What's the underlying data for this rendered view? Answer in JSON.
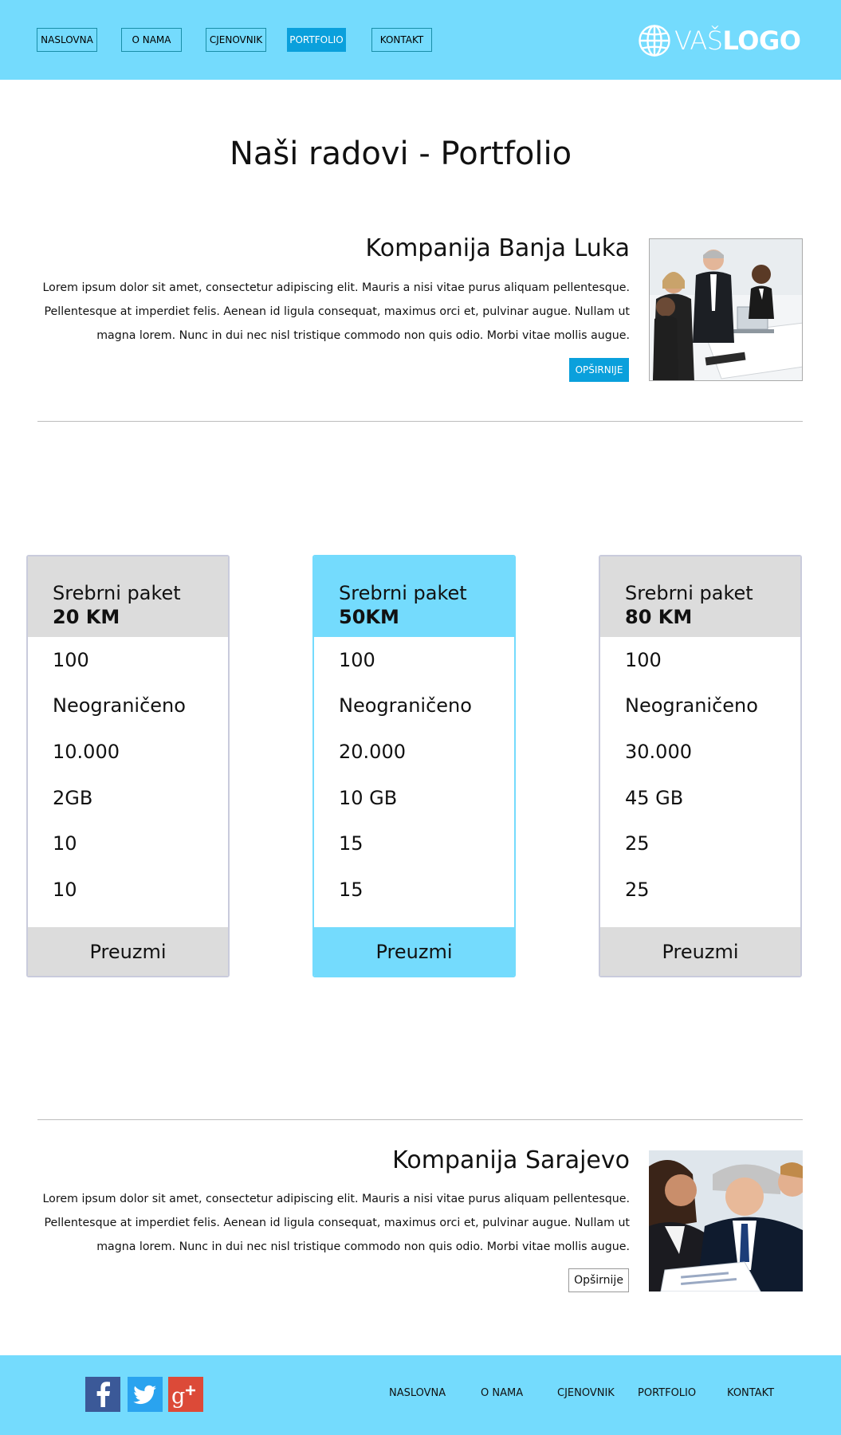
{
  "header": {
    "nav": [
      {
        "label": "NASLOVNA",
        "active": false
      },
      {
        "label": "O NAMA",
        "active": false
      },
      {
        "label": "CJENOVNIK",
        "active": false
      },
      {
        "label": "PORTFOLIO",
        "active": true
      },
      {
        "label": "KONTAKT",
        "active": false
      }
    ],
    "logo": {
      "prefix": "VAŠ",
      "suffix": "LOGO",
      "icon": "globe-icon"
    }
  },
  "page_title": "Naši radovi - Portfolio",
  "portfolio": [
    {
      "title": "Kompanija Banja Luka",
      "description": "Lorem ipsum dolor sit amet, consectetur adipiscing elit. Mauris a nisi vitae purus aliquam pellentesque. Pellentesque at imperdiet felis. Aenean id ligula consequat, maximus orci et, pulvinar augue. Nullam ut magna lorem. Nunc in dui nec nisl tristique commodo non quis odio. Morbi vitae mollis augue.",
      "button": "OPŠIRNIJE",
      "image": "business-team-meeting-photo"
    },
    {
      "title": "Kompanija Sarajevo",
      "description": "Lorem ipsum dolor sit amet, consectetur adipiscing elit. Mauris a nisi vitae purus aliquam pellentesque. Pellentesque at imperdiet felis. Aenean id ligula consequat, maximus orci et, pulvinar augue. Nullam ut magna lorem. Nunc in dui nec nisl tristique commodo non quis odio. Morbi vitae mollis augue.",
      "button": "Opširnije",
      "image": "business-people-reviewing-documents-photo"
    }
  ],
  "pricing": [
    {
      "name": "Srebrni paket",
      "price": "20 KM",
      "features": [
        "100",
        "Neograničeno",
        "10.000",
        "2GB",
        "10",
        "10"
      ],
      "button": "Preuzmi",
      "featured": false
    },
    {
      "name": "Srebrni paket",
      "price": "50KM",
      "features": [
        "100",
        "Neograničeno",
        "20.000",
        "10 GB",
        "15",
        "15"
      ],
      "button": "Preuzmi",
      "featured": true
    },
    {
      "name": "Srebrni paket",
      "price": "80 KM",
      "features": [
        "100",
        "Neograničeno",
        "30.000",
        "45 GB",
        "25",
        "25"
      ],
      "button": "Preuzmi",
      "featured": false
    }
  ],
  "footer": {
    "social": [
      {
        "icon": "facebook-icon",
        "color": "#3b5998"
      },
      {
        "icon": "twitter-icon",
        "color": "#2aa3ef"
      },
      {
        "icon": "google-plus-icon",
        "color": "#dc4a38"
      }
    ],
    "links": [
      "NASLOVNA",
      "O NAMA",
      "CJENOVNIK",
      "PORTFOLIO",
      "KONTAKT"
    ]
  },
  "colors": {
    "header_bg": "#74dbfd",
    "accent": "#0aa0dc",
    "card_gray": "#dcdcdc",
    "divider": "#bdbdbd"
  }
}
